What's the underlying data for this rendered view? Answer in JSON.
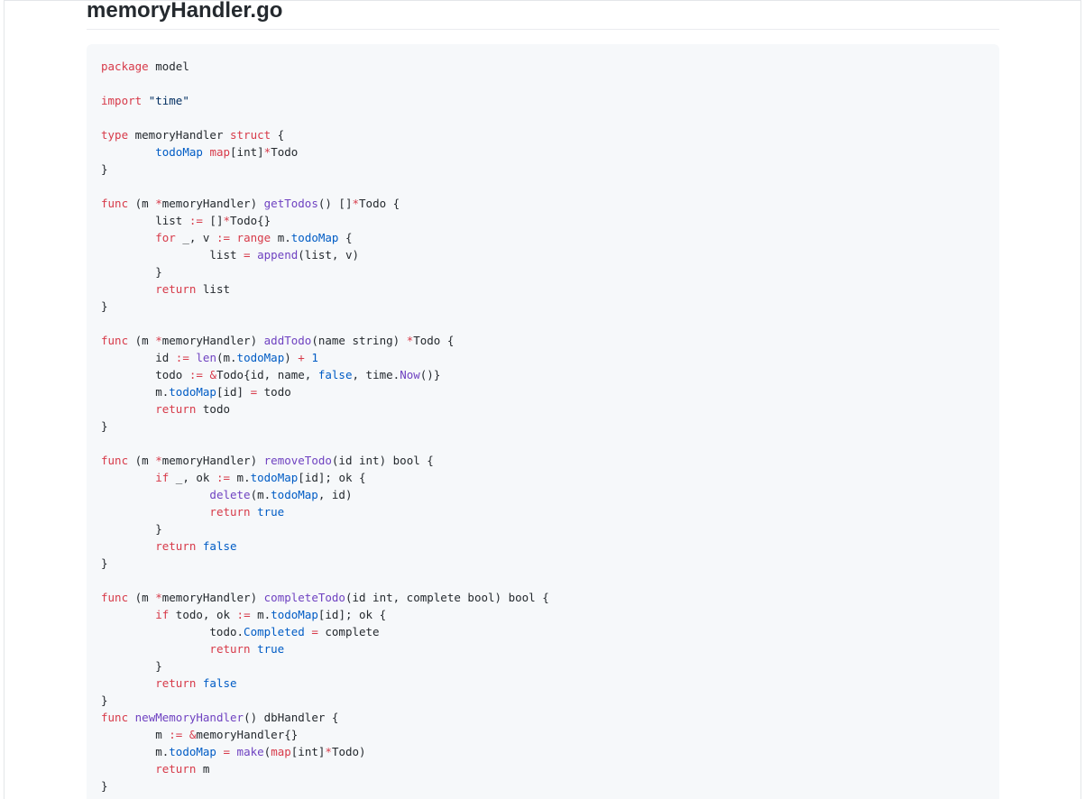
{
  "file_title": "memoryHandler.go",
  "colors": {
    "keyword": "#d73a49",
    "function": "#6f42c1",
    "constant": "#005cc5",
    "string": "#032f62",
    "text": "#24292e",
    "code_background": "#f6f8fa"
  },
  "code": {
    "language": "go",
    "lines": [
      [
        [
          "kw",
          "package"
        ],
        [
          "t",
          " model"
        ]
      ],
      [],
      [
        [
          "kw",
          "import"
        ],
        [
          "t",
          " "
        ],
        [
          "str",
          "\"time\""
        ]
      ],
      [],
      [
        [
          "kw",
          "type"
        ],
        [
          "t",
          " memoryHandler "
        ],
        [
          "kw",
          "struct"
        ],
        [
          "t",
          " {"
        ]
      ],
      [
        [
          "t",
          "        "
        ],
        [
          "c1",
          "todoMap"
        ],
        [
          "t",
          " "
        ],
        [
          "kw",
          "map"
        ],
        [
          "t",
          "[int]"
        ],
        [
          "kw",
          "*"
        ],
        [
          "t",
          "Todo"
        ]
      ],
      [
        [
          "t",
          "}"
        ]
      ],
      [],
      [
        [
          "kw",
          "func"
        ],
        [
          "t",
          " (m "
        ],
        [
          "kw",
          "*"
        ],
        [
          "t",
          "memoryHandler) "
        ],
        [
          "fn",
          "getTodos"
        ],
        [
          "t",
          "() []"
        ],
        [
          "kw",
          "*"
        ],
        [
          "t",
          "Todo {"
        ]
      ],
      [
        [
          "t",
          "        list "
        ],
        [
          "kw",
          ":="
        ],
        [
          "t",
          " []"
        ],
        [
          "kw",
          "*"
        ],
        [
          "t",
          "Todo{}"
        ]
      ],
      [
        [
          "t",
          "        "
        ],
        [
          "kw",
          "for"
        ],
        [
          "t",
          " _, v "
        ],
        [
          "kw",
          ":="
        ],
        [
          "t",
          " "
        ],
        [
          "kw",
          "range"
        ],
        [
          "t",
          " m."
        ],
        [
          "c1",
          "todoMap"
        ],
        [
          "t",
          " {"
        ]
      ],
      [
        [
          "t",
          "                list "
        ],
        [
          "kw",
          "="
        ],
        [
          "t",
          " "
        ],
        [
          "fn",
          "append"
        ],
        [
          "t",
          "(list, v)"
        ]
      ],
      [
        [
          "t",
          "        }"
        ]
      ],
      [
        [
          "t",
          "        "
        ],
        [
          "kw",
          "return"
        ],
        [
          "t",
          " list"
        ]
      ],
      [
        [
          "t",
          "}"
        ]
      ],
      [],
      [
        [
          "kw",
          "func"
        ],
        [
          "t",
          " (m "
        ],
        [
          "kw",
          "*"
        ],
        [
          "t",
          "memoryHandler) "
        ],
        [
          "fn",
          "addTodo"
        ],
        [
          "t",
          "(name string) "
        ],
        [
          "kw",
          "*"
        ],
        [
          "t",
          "Todo {"
        ]
      ],
      [
        [
          "t",
          "        id "
        ],
        [
          "kw",
          ":="
        ],
        [
          "t",
          " "
        ],
        [
          "fn",
          "len"
        ],
        [
          "t",
          "(m."
        ],
        [
          "c1",
          "todoMap"
        ],
        [
          "t",
          ") "
        ],
        [
          "kw",
          "+"
        ],
        [
          "t",
          " "
        ],
        [
          "c1",
          "1"
        ]
      ],
      [
        [
          "t",
          "        todo "
        ],
        [
          "kw",
          ":="
        ],
        [
          "t",
          " "
        ],
        [
          "kw",
          "&"
        ],
        [
          "t",
          "Todo{id, name, "
        ],
        [
          "c1",
          "false"
        ],
        [
          "t",
          ", time."
        ],
        [
          "fn",
          "Now"
        ],
        [
          "t",
          "()}"
        ]
      ],
      [
        [
          "t",
          "        m."
        ],
        [
          "c1",
          "todoMap"
        ],
        [
          "t",
          "[id] "
        ],
        [
          "kw",
          "="
        ],
        [
          "t",
          " todo"
        ]
      ],
      [
        [
          "t",
          "        "
        ],
        [
          "kw",
          "return"
        ],
        [
          "t",
          " todo"
        ]
      ],
      [
        [
          "t",
          "}"
        ]
      ],
      [],
      [
        [
          "kw",
          "func"
        ],
        [
          "t",
          " (m "
        ],
        [
          "kw",
          "*"
        ],
        [
          "t",
          "memoryHandler) "
        ],
        [
          "fn",
          "removeTodo"
        ],
        [
          "t",
          "(id int) bool {"
        ]
      ],
      [
        [
          "t",
          "        "
        ],
        [
          "kw",
          "if"
        ],
        [
          "t",
          " _, ok "
        ],
        [
          "kw",
          ":="
        ],
        [
          "t",
          " m."
        ],
        [
          "c1",
          "todoMap"
        ],
        [
          "t",
          "[id]; ok {"
        ]
      ],
      [
        [
          "t",
          "                "
        ],
        [
          "fn",
          "delete"
        ],
        [
          "t",
          "(m."
        ],
        [
          "c1",
          "todoMap"
        ],
        [
          "t",
          ", id)"
        ]
      ],
      [
        [
          "t",
          "                "
        ],
        [
          "kw",
          "return"
        ],
        [
          "t",
          " "
        ],
        [
          "c1",
          "true"
        ]
      ],
      [
        [
          "t",
          "        }"
        ]
      ],
      [
        [
          "t",
          "        "
        ],
        [
          "kw",
          "return"
        ],
        [
          "t",
          " "
        ],
        [
          "c1",
          "false"
        ]
      ],
      [
        [
          "t",
          "}"
        ]
      ],
      [],
      [
        [
          "kw",
          "func"
        ],
        [
          "t",
          " (m "
        ],
        [
          "kw",
          "*"
        ],
        [
          "t",
          "memoryHandler) "
        ],
        [
          "fn",
          "completeTodo"
        ],
        [
          "t",
          "(id int, complete bool) bool {"
        ]
      ],
      [
        [
          "t",
          "        "
        ],
        [
          "kw",
          "if"
        ],
        [
          "t",
          " todo, ok "
        ],
        [
          "kw",
          ":="
        ],
        [
          "t",
          " m."
        ],
        [
          "c1",
          "todoMap"
        ],
        [
          "t",
          "[id]; ok {"
        ]
      ],
      [
        [
          "t",
          "                todo."
        ],
        [
          "c1",
          "Completed"
        ],
        [
          "t",
          " "
        ],
        [
          "kw",
          "="
        ],
        [
          "t",
          " complete"
        ]
      ],
      [
        [
          "t",
          "                "
        ],
        [
          "kw",
          "return"
        ],
        [
          "t",
          " "
        ],
        [
          "c1",
          "true"
        ]
      ],
      [
        [
          "t",
          "        }"
        ]
      ],
      [
        [
          "t",
          "        "
        ],
        [
          "kw",
          "return"
        ],
        [
          "t",
          " "
        ],
        [
          "c1",
          "false"
        ]
      ],
      [
        [
          "t",
          "}"
        ]
      ],
      [
        [
          "kw",
          "func"
        ],
        [
          "t",
          " "
        ],
        [
          "fn",
          "newMemoryHandler"
        ],
        [
          "t",
          "() dbHandler {"
        ]
      ],
      [
        [
          "t",
          "        m "
        ],
        [
          "kw",
          ":="
        ],
        [
          "t",
          " "
        ],
        [
          "kw",
          "&"
        ],
        [
          "t",
          "memoryHandler{}"
        ]
      ],
      [
        [
          "t",
          "        m."
        ],
        [
          "c1",
          "todoMap"
        ],
        [
          "t",
          " "
        ],
        [
          "kw",
          "="
        ],
        [
          "t",
          " "
        ],
        [
          "fn",
          "make"
        ],
        [
          "t",
          "("
        ],
        [
          "kw",
          "map"
        ],
        [
          "t",
          "[int]"
        ],
        [
          "kw",
          "*"
        ],
        [
          "t",
          "Todo)"
        ]
      ],
      [
        [
          "t",
          "        "
        ],
        [
          "kw",
          "return"
        ],
        [
          "t",
          " m"
        ]
      ],
      [
        [
          "t",
          "}"
        ]
      ]
    ]
  }
}
